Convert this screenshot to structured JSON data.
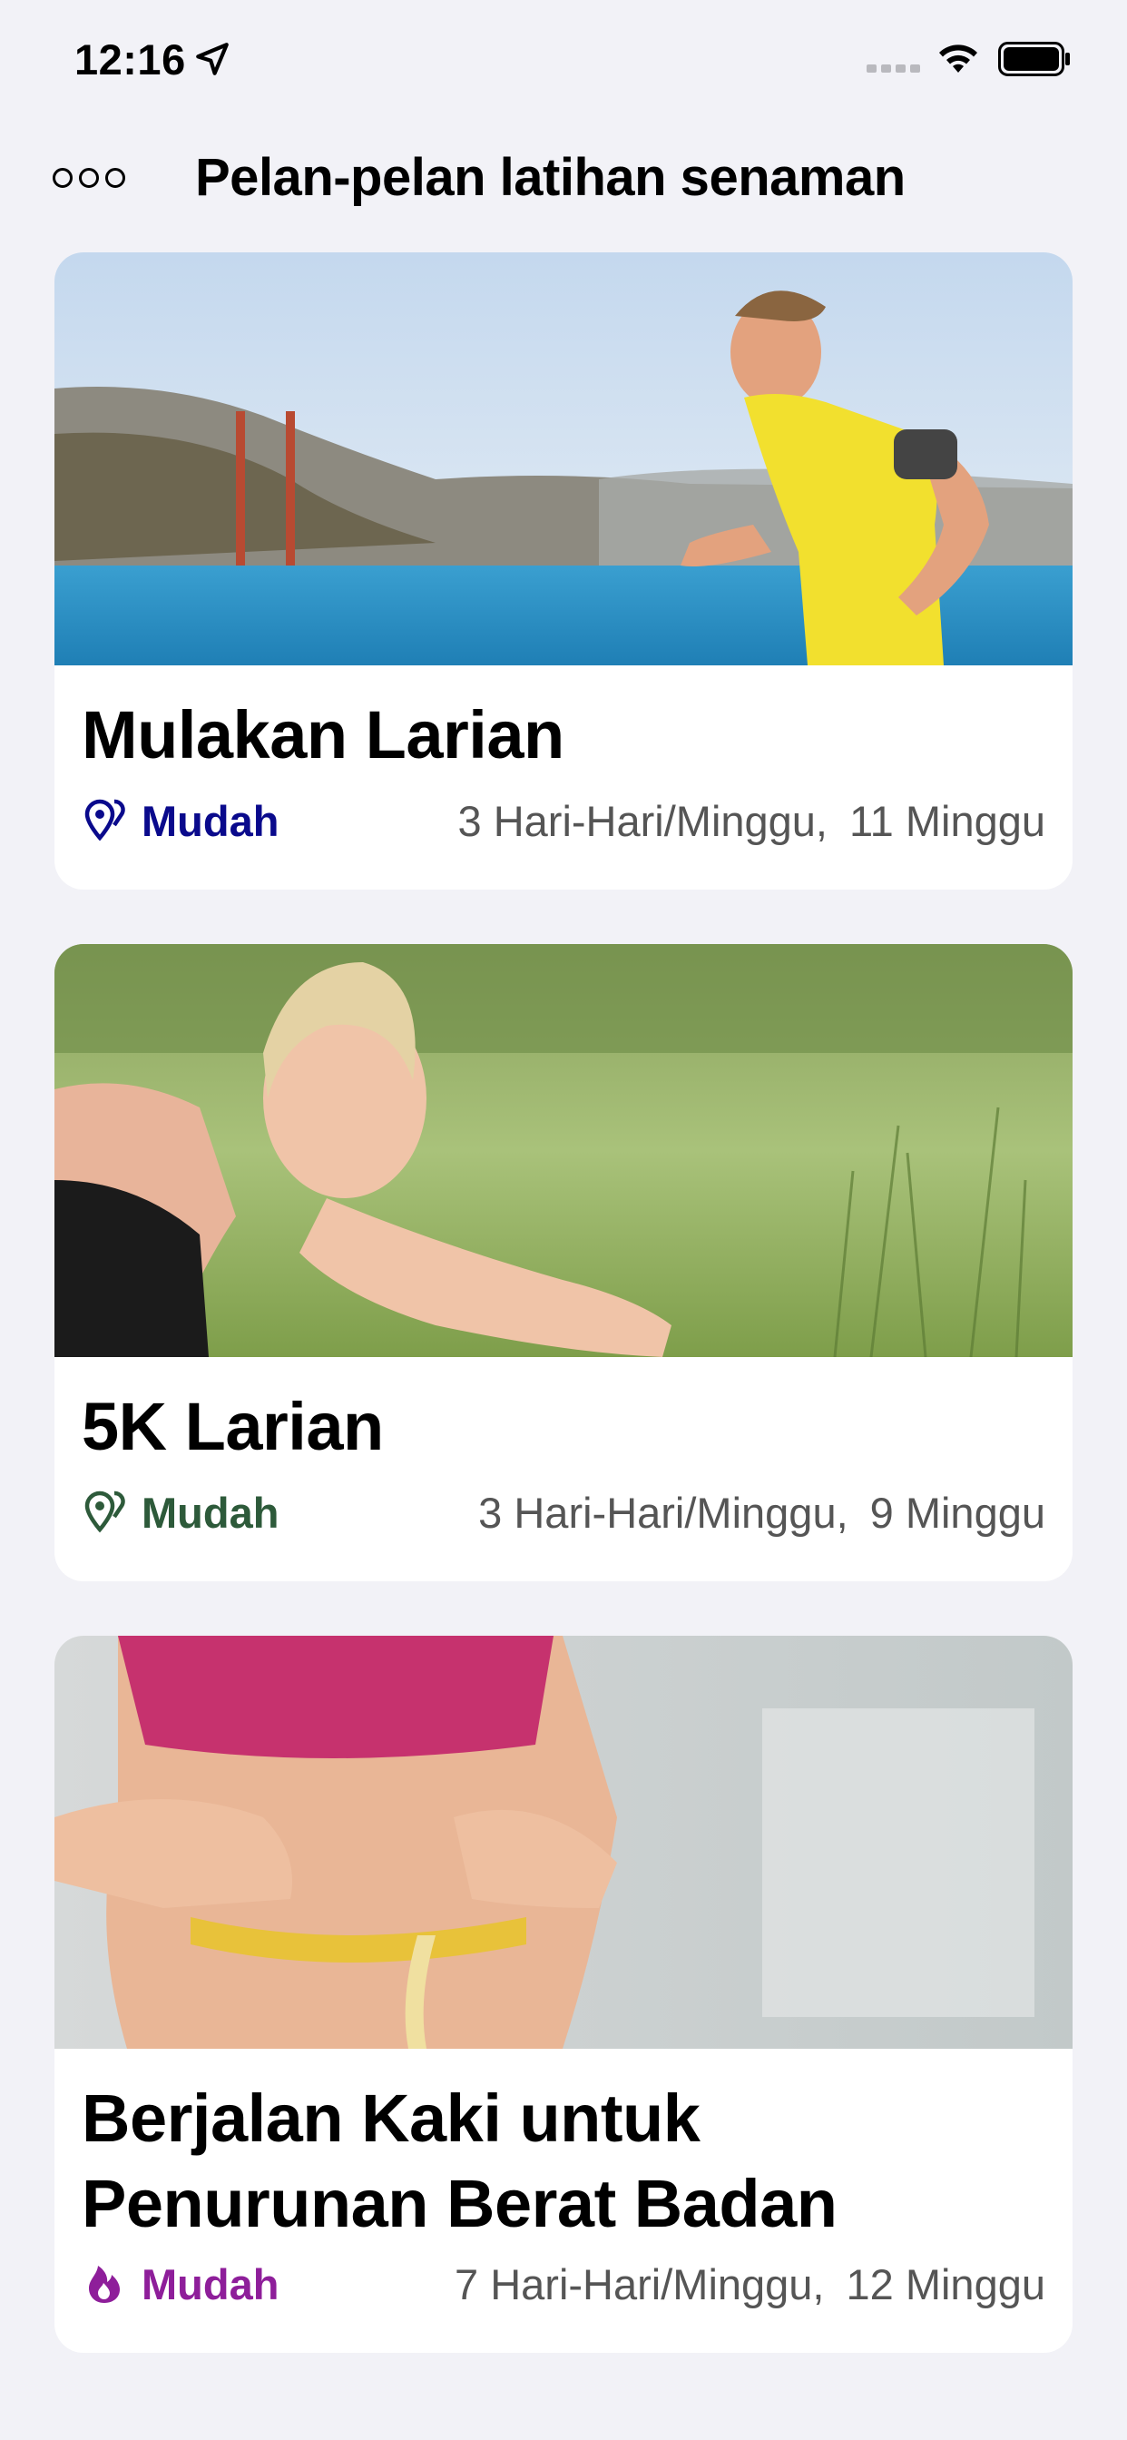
{
  "status_bar": {
    "time": "12:16",
    "icons": [
      "location-arrow-icon",
      "cellular-signal-icon",
      "wifi-icon",
      "battery-icon"
    ]
  },
  "nav": {
    "title": "Pelan-pelan latihan senaman",
    "more_icon": "more-dots-icon"
  },
  "plans": [
    {
      "title": "Mulakan Larian",
      "image": "runner-man-by-bay-photo",
      "level_icon": "map-pin-icon",
      "level": "Mudah",
      "level_color": "#0a0a8c",
      "frequency": "3 Hari-Hari/Minggu,",
      "duration": "11 Minggu"
    },
    {
      "title": "5K Larian",
      "image": "woman-stretching-in-grass-photo",
      "level_icon": "map-pin-icon",
      "level": "Mudah",
      "level_color": "#2d5a3a",
      "frequency": "3 Hari-Hari/Minggu,",
      "duration": "9 Minggu"
    },
    {
      "title": "Berjalan Kaki untuk Penurunan Berat Badan",
      "image": "waist-tape-measure-photo",
      "level_icon": "flame-icon",
      "level": "Mudah",
      "level_color": "#8e1e9a",
      "frequency": "7 Hari-Hari/Minggu,",
      "duration": "12 Minggu"
    }
  ],
  "colors": {
    "background": "#f2f2f7",
    "card": "#ffffff",
    "secondary_text": "#555555"
  }
}
